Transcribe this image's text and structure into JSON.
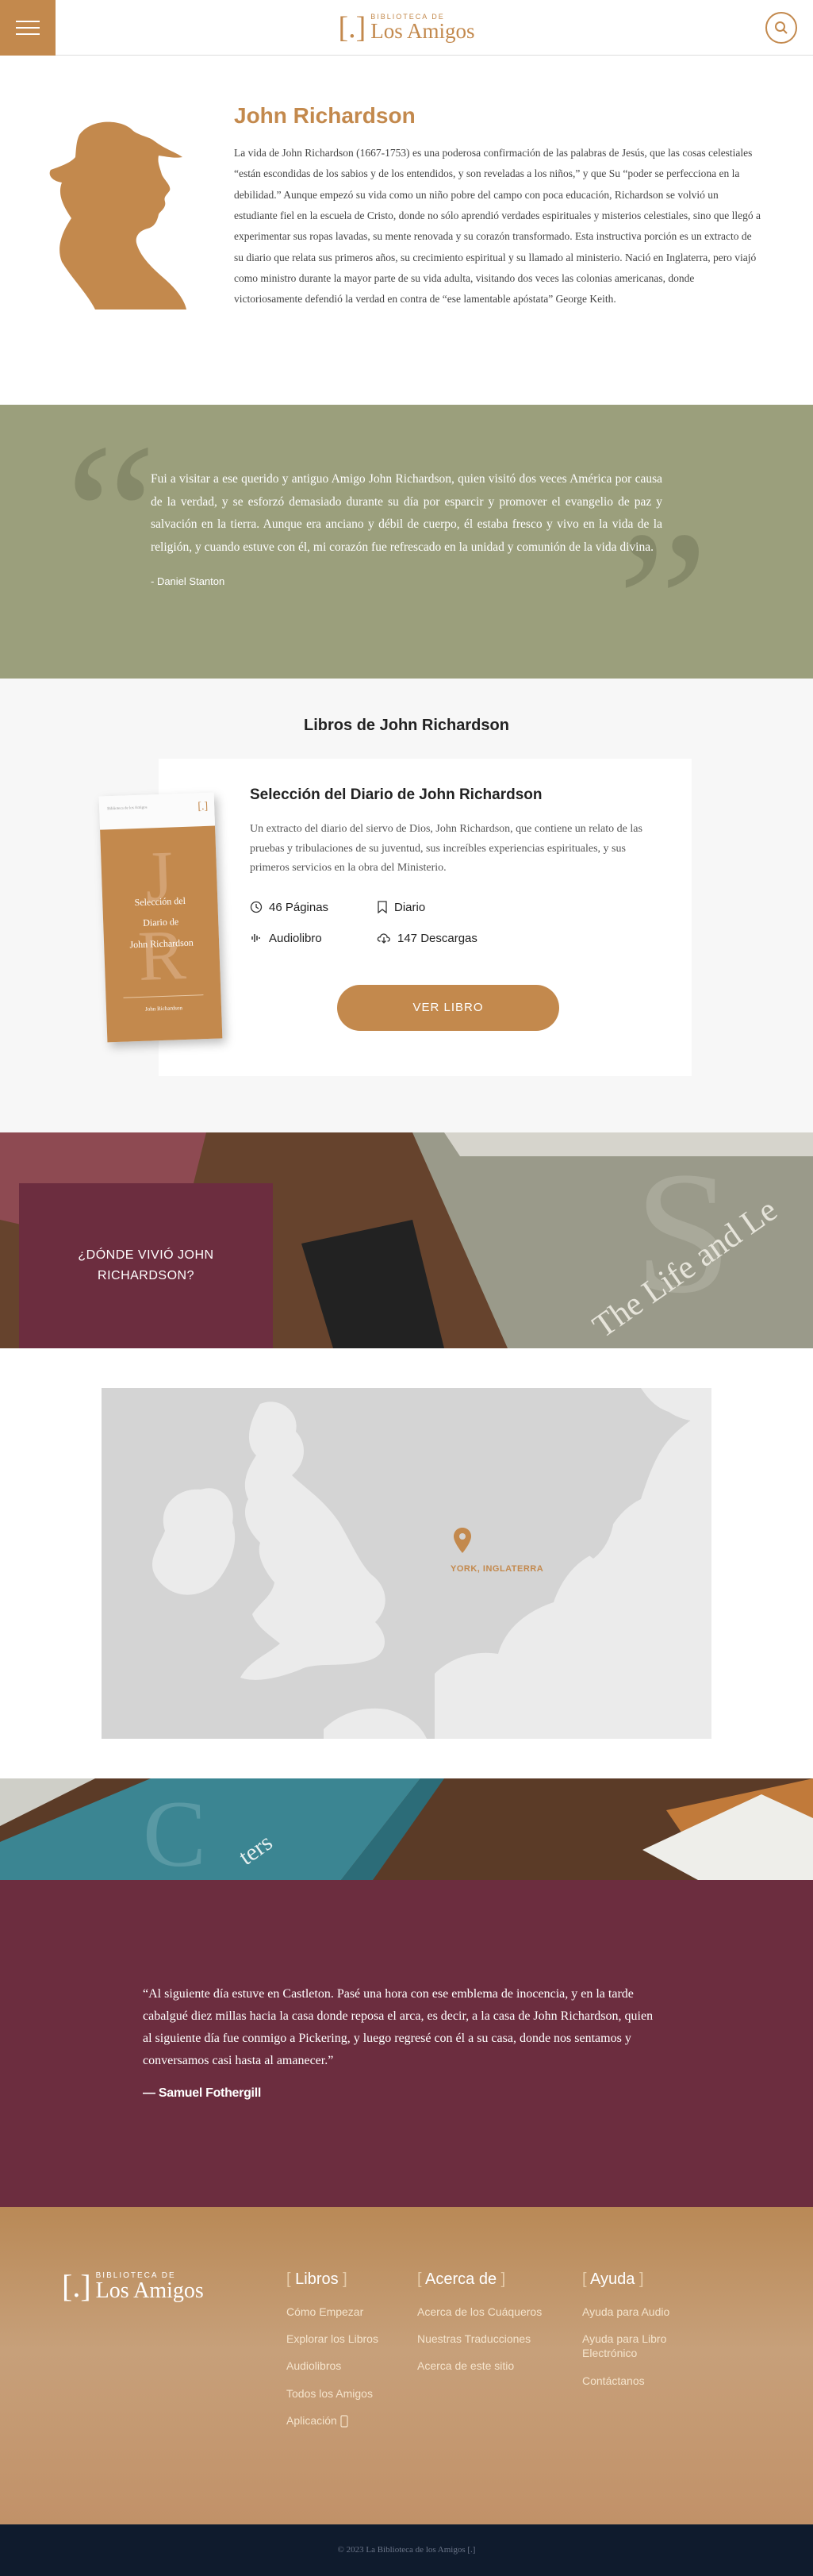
{
  "header": {
    "logo_small": "BIBLIOTECA DE",
    "logo_big": "Los Amigos",
    "logo_mark": "[.]",
    "menu_icon": "hamburger-icon",
    "search_icon": "search-icon"
  },
  "author": {
    "name": "John Richardson",
    "bio": "La vida de John Richardson (1667-1753) es una poderosa confirmación de las palabras de Jesús, que las cosas celestiales “están escondidas de los sabios y de los entendidos, y son reveladas a los niños,” y que Su “poder se perfecciona en la debilidad.” Aunque empezó su vida como un niño pobre del campo con poca educación, Richardson se volvió un estudiante fiel en la escuela de Cristo, donde no sólo aprendió verdades espirituales y misterios celestiales, sino que llegó a experimentar sus ropas lavadas, su mente renovada y su corazón transformado. Esta instructiva porción es un extracto de su diario que relata sus primeros años, su crecimiento espiritual y su llamado al ministerio. Nació en Inglaterra, pero viajó como ministro durante la mayor parte de su vida adulta, visitando dos veces las colonias americanas, donde victoriosamente defendió la verdad en contra de “ese lamentable apóstata” George Keith."
  },
  "quote1": {
    "text": "Fui a visitar a ese querido y antiguo Amigo John Richardson, quien visitó dos veces América por causa de la verdad, y se esforzó demasiado durante su día por esparcir y promover el evangelio de paz y salvación en la tierra. Aunque era anciano y débil de cuerpo, él estaba fresco y vivo en la vida de la religión, y cuando estuve con él, mi corazón fue refrescado en la unidad y comunión de la vida divina.",
    "author": "- Daniel Stanton"
  },
  "books": {
    "title": "Libros de John Richardson",
    "book": {
      "title": "Selección del Diario de John Richardson",
      "cover_top": "Biblioteca de los Amigos",
      "cover_title_1": "Selección del",
      "cover_title_2": "Diario de",
      "cover_title_3": "John Richardson",
      "cover_author": "John Richardson",
      "description": "Un extracto del diario del siervo de Dios, John Richardson, que contiene un relato de las pruebas y tribulaciones de su juventud, sus increíbles experiencias espirituales, y sus primeros servicios en la obra del Ministerio.",
      "pages": "46 Páginas",
      "type": "Diario",
      "audio": "Audiolibro",
      "downloads": "147 Descargas",
      "button": "VER LIBRO"
    }
  },
  "where": {
    "title": "¿DÓNDE VIVIÓ JOHN RICHARDSON?"
  },
  "map": {
    "label": "YORK, INGLATERRA"
  },
  "quote2": {
    "text": "“Al siguiente día estuve en Castleton. Pasé una hora con ese emblema de inocencia, y en la tarde cabalgué diez millas hacia la casa donde reposa el arca, es decir, a la casa de John Richardson, quien al siguiente día fue conmigo a Pickering, y luego regresé con él a su casa, donde nos sentamos y conversamos casi hasta al amanecer.”",
    "author": "— Samuel Fothergill"
  },
  "footer": {
    "logo_small": "BIBLIOTECA DE",
    "logo_big": "Los Amigos",
    "col1": {
      "title": "Libros",
      "links": [
        "Cómo Empezar",
        "Explorar los Libros",
        "Audiolibros",
        "Todos los Amigos",
        "Aplicación"
      ]
    },
    "col2": {
      "title": "Acerca de",
      "links": [
        "Acerca de los Cuáqueros",
        "Nuestras Traducciones",
        "Acerca de este sitio"
      ]
    },
    "col3": {
      "title": "Ayuda",
      "links": [
        "Ayuda para Audio",
        "Ayuda para Libro Electrónico",
        "Contáctanos"
      ]
    }
  },
  "copyright": "© 2023 La Biblioteca de los Amigos [.]",
  "colors": {
    "accent": "#c3894d",
    "olive": "#9b9f7c",
    "maroon": "#6c2d3f",
    "navy": "#0f1b2d"
  }
}
